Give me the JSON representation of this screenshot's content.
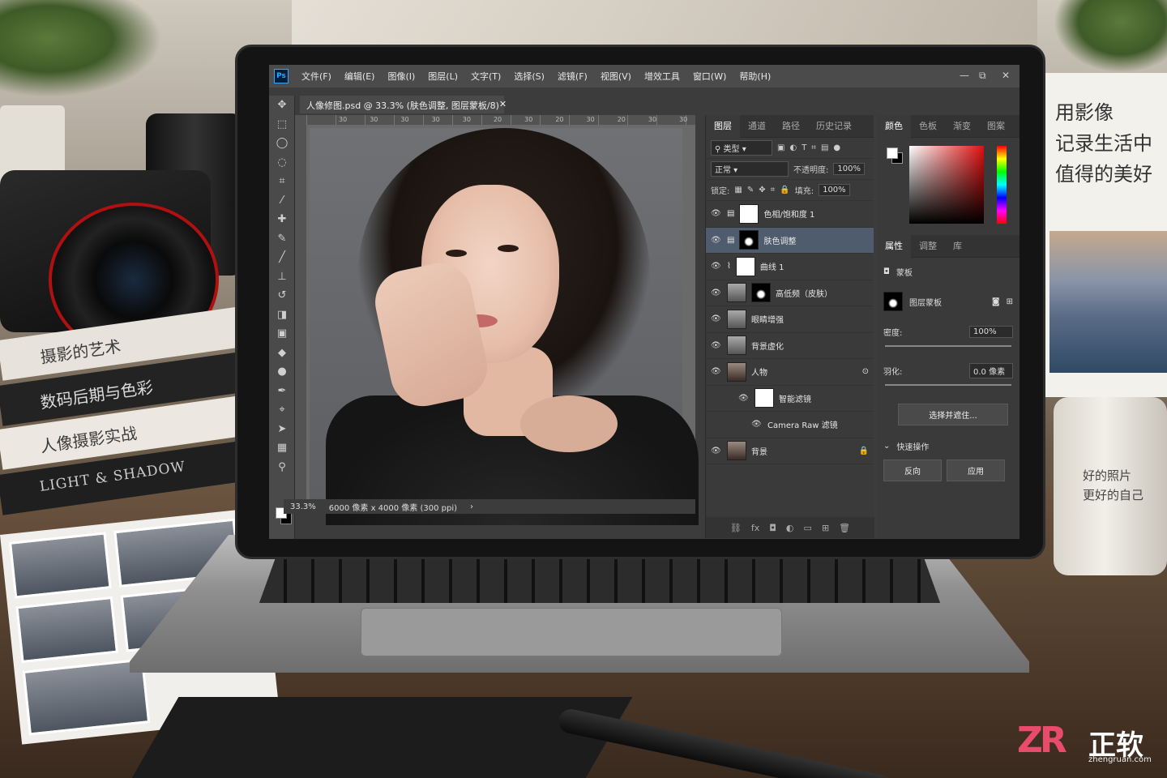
{
  "ps": {
    "logo": "Ps",
    "menu": [
      "文件(F)",
      "编辑(E)",
      "图像(I)",
      "图层(L)",
      "文字(T)",
      "选择(S)",
      "滤镜(F)",
      "视图(V)",
      "增效工具",
      "窗口(W)",
      "帮助(H)"
    ],
    "window_controls": {
      "minimize": "—",
      "restore": "⧉",
      "close": "✕"
    },
    "doc_tab": "人像修图.psd @ 33.3% (肤色调整, 图层蒙板/8)",
    "doc_tab_close": "✕",
    "ruler_ticks": [
      "30",
      "30",
      "30",
      "30",
      "30",
      "20",
      "30",
      "20",
      "30",
      "20",
      "30",
      "30"
    ],
    "status": {
      "zoom": "33.3%",
      "info": "6000 像素 x 4000 像素 (300 ppi)",
      "arrow": "›"
    }
  },
  "layers_panel": {
    "tabs": [
      "图层",
      "通道",
      "路径",
      "历史记录"
    ],
    "filter_kind": "类型",
    "blend_mode": "正常",
    "opacity_label": "不透明度:",
    "opacity_value": "100%",
    "lock_label": "锁定:",
    "fill_label": "填充:",
    "fill_value": "100%",
    "layers": [
      {
        "name": "色相/饱和度 1",
        "visible": true,
        "selected": false
      },
      {
        "name": "肤色调整",
        "visible": true,
        "selected": true
      },
      {
        "name": "曲线 1",
        "visible": true,
        "selected": false
      },
      {
        "name": "高低频（皮肤）",
        "visible": true,
        "selected": false
      },
      {
        "name": "眼睛增强",
        "visible": true,
        "selected": false
      },
      {
        "name": "背景虚化",
        "visible": true,
        "selected": false
      },
      {
        "name": "人物",
        "visible": true,
        "selected": false
      },
      {
        "name": "智能滤镜",
        "visible": true,
        "selected": false
      },
      {
        "name": "Camera Raw 滤镜",
        "visible": true,
        "selected": false
      },
      {
        "name": "背景",
        "visible": true,
        "selected": false
      }
    ]
  },
  "color_panel": {
    "tabs": [
      "颜色",
      "色板",
      "渐变",
      "图案"
    ]
  },
  "properties_panel": {
    "tabs": [
      "属性",
      "调整",
      "库"
    ],
    "mask_label": "蒙板",
    "layer_mask_label": "图层蒙板",
    "density_label": "密度:",
    "density_value": "100%",
    "feather_label": "羽化:",
    "feather_value": "0.0 像素",
    "select_mask_button": "选择并遮住...",
    "quick_actions_label": "快速操作",
    "invert_button": "反向",
    "apply_button": "应用"
  },
  "scene": {
    "books": [
      "摄影的艺术",
      "数码后期与色彩",
      "人像摄影实战",
      "LIGHT & SHADOW"
    ],
    "card_lines": [
      "用影像",
      "记录生活中",
      "值得的美好"
    ],
    "mug_lines": [
      "好的照片",
      "更好的自己"
    ],
    "logo": {
      "mark": "ZR",
      "name": "正软",
      "url": "zhengruan.com"
    }
  }
}
